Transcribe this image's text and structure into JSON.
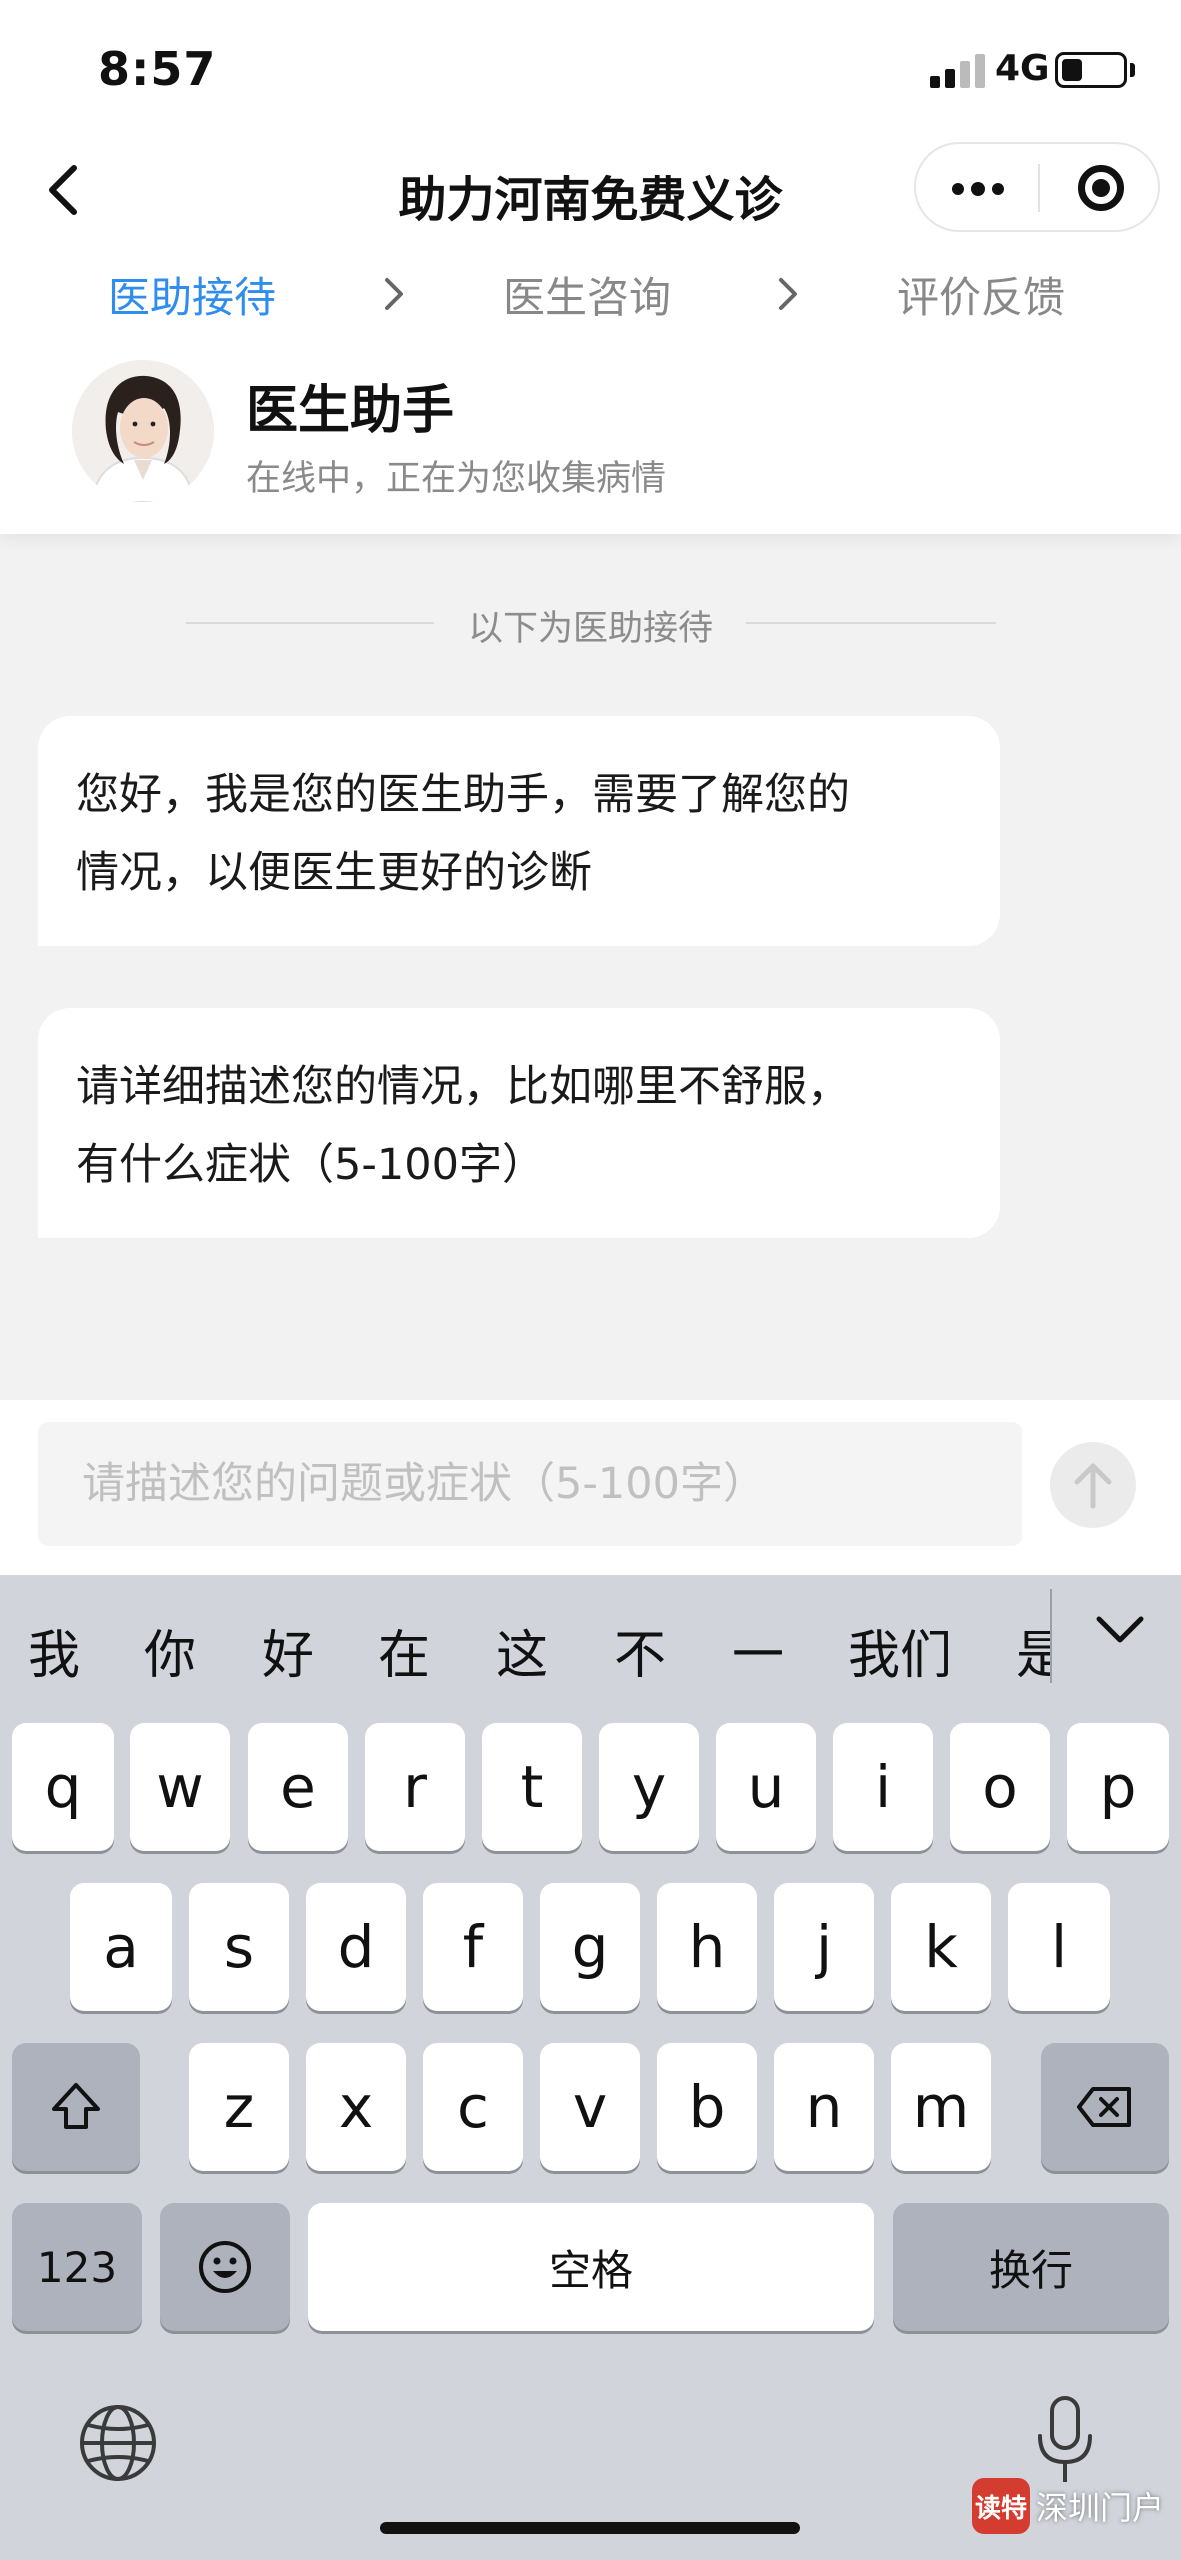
{
  "status_bar": {
    "time": "8:57",
    "network": "4G",
    "battery_level": 0.35
  },
  "navbar": {
    "title": "助力河南免费义诊",
    "back_icon": "chevron-left-icon",
    "more_icon": "more-dots-icon",
    "target_icon": "target-icon"
  },
  "steps": [
    {
      "label": "医助接待",
      "active": true
    },
    {
      "label": "医生咨询",
      "active": false
    },
    {
      "label": "评价反馈",
      "active": false
    }
  ],
  "assistant": {
    "name": "医生助手",
    "status": "在线中，正在为您收集病情"
  },
  "chat": {
    "divider": "以下为医助接待",
    "messages": [
      {
        "line1": "您好，我是您的医生助手，需要了解您的",
        "line2": "情况，以便医生更好的诊断"
      },
      {
        "line1": "请详细描述您的情况，比如哪里不舒服，",
        "line2": "有什么症状（5-100字）"
      }
    ]
  },
  "input": {
    "placeholder": "请描述您的问题或症状（5-100字）",
    "value": "",
    "send_icon": "arrow-up-icon"
  },
  "keyboard": {
    "candidates": [
      "我",
      "你",
      "好",
      "在",
      "这",
      "不",
      "一",
      "我们",
      "是"
    ],
    "row1": [
      "q",
      "w",
      "e",
      "r",
      "t",
      "y",
      "u",
      "i",
      "o",
      "p"
    ],
    "row2": [
      "a",
      "s",
      "d",
      "f",
      "g",
      "h",
      "j",
      "k",
      "l"
    ],
    "row3": [
      "z",
      "x",
      "c",
      "v",
      "b",
      "n",
      "m"
    ],
    "numbers_label": "123",
    "space_label": "空格",
    "return_label": "换行",
    "icons": {
      "shift": "shift-icon",
      "delete": "backspace-icon",
      "emoji": "emoji-icon",
      "globe": "globe-icon",
      "mic": "microphone-icon",
      "collapse": "chevron-down-icon"
    }
  },
  "colors": {
    "accent": "#2e8ded",
    "background": "#f2f2f2",
    "keyboard": "#d1d4db"
  },
  "watermark": {
    "logo_text": "读特",
    "text": "深圳门户"
  }
}
